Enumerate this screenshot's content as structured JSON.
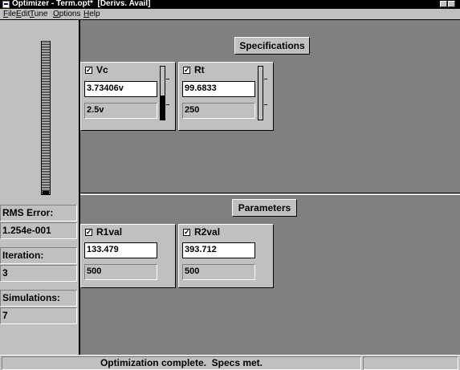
{
  "window": {
    "title": "Optimizer - Term.opt*  [Derivs. Avail]",
    "icon": "optimizer-app-icon"
  },
  "menu": [
    {
      "label": "File",
      "underline": "F",
      "rest": "ile"
    },
    {
      "label": "Edit",
      "underline": "E",
      "rest": "dit"
    },
    {
      "label": "Tune",
      "underline": "T",
      "rest": "une"
    },
    {
      "label": "Options",
      "underline": "O",
      "rest": "ptions"
    },
    {
      "label": "Help",
      "underline": "H",
      "rest": "elp"
    }
  ],
  "left_panel": {
    "error_gauge_level": 0.02,
    "rms_error_label": "RMS Error:",
    "rms_error_value": "1.254e-001",
    "iteration_label": "Iteration:",
    "iteration_value": "3",
    "simulations_label": "Simulations:",
    "simulations_value": "7"
  },
  "specifications": {
    "header": "Specifications",
    "cards": [
      {
        "name": "Vc",
        "checked": true,
        "value": "3.73406v",
        "target": "2.5v",
        "bar_level": 0.45
      },
      {
        "name": "Rt",
        "checked": true,
        "value": "99.6833",
        "target": "250",
        "bar_level": 0.0
      }
    ]
  },
  "parameters": {
    "header": "Parameters",
    "cards": [
      {
        "name": "R1val",
        "checked": true,
        "value": "133.479",
        "limit": "500"
      },
      {
        "name": "R2val",
        "checked": true,
        "value": "393.712",
        "limit": "500"
      }
    ]
  },
  "status": {
    "message": "Optimization complete.  Specs met."
  },
  "colors": {
    "window_bg": "#c0c0c0",
    "panel_bg": "#808080",
    "title_bar": "#000000"
  }
}
